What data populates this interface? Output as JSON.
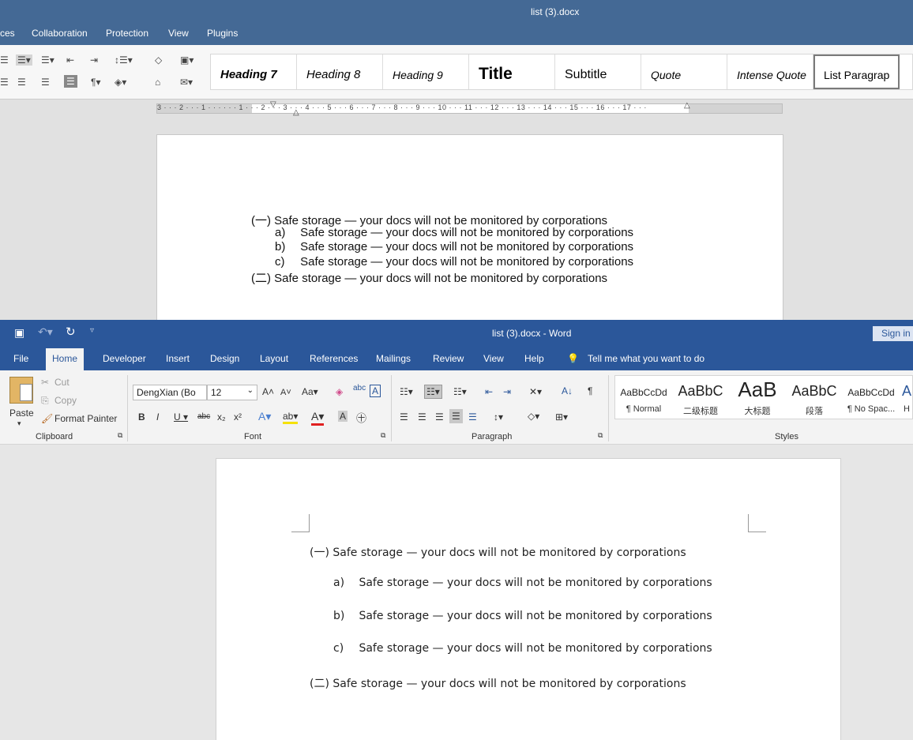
{
  "top_editor": {
    "title": "list (3).docx",
    "tabs": [
      "ces",
      "Collaboration",
      "Protection",
      "View",
      "Plugins"
    ],
    "styles": [
      "Heading 7",
      "Heading 8",
      "Heading 9",
      "Title",
      "Subtitle",
      "Quote",
      "Intense Quote",
      "List Paragrap"
    ],
    "ruler_text": "3 · · · 2 · · · 1 · · · · · · 1 · · · 2 · · · 3 · · · 4 · · · 5 · · · 6 · · · 7 · · · 8 · · · 9 · · · 10 · · · 11 · · · 12 · · · 13 · · · 14 · · · 15 · · · 16 · · · 17 · · ·",
    "document": [
      {
        "marker": "(一)",
        "text": "Safe storage — your docs will not be monitored by corporations"
      },
      {
        "marker": "a)",
        "text": "Safe storage — your docs will not be monitored by corporations"
      },
      {
        "marker": "b)",
        "text": "Safe storage — your docs will not be monitored by corporations"
      },
      {
        "marker": "c)",
        "text": "Safe storage — your docs will not be monitored by corporations"
      },
      {
        "marker": "(二)",
        "text": "Safe storage — your docs will not be monitored by corporations"
      }
    ]
  },
  "word": {
    "title": "list (3).docx  -  Word",
    "sign_in": "Sign in",
    "tabs": [
      "File",
      "Home",
      "Developer",
      "Insert",
      "Design",
      "Layout",
      "References",
      "Mailings",
      "Review",
      "View",
      "Help"
    ],
    "tell_me": "Tell me what you want to do",
    "clipboard": {
      "paste": "Paste",
      "cut": "Cut",
      "copy": "Copy",
      "format_painter": "Format Painter",
      "label": "Clipboard"
    },
    "font": {
      "name": "DengXian (Bo",
      "size": "12",
      "label": "Font"
    },
    "paragraph": {
      "label": "Paragraph"
    },
    "styles": {
      "label": "Styles",
      "items": [
        {
          "sample": "AaBbCcDd",
          "name": "¶ Normal"
        },
        {
          "sample": "AaBbC",
          "name": "二级标题"
        },
        {
          "sample": "AaB",
          "name": "大标题"
        },
        {
          "sample": "AaBbC",
          "name": "段落"
        },
        {
          "sample": "AaBbCcDd",
          "name": "¶ No Spac..."
        },
        {
          "sample": "A",
          "name": "H"
        }
      ]
    },
    "document": [
      {
        "marker": "(一)",
        "text": "Safe storage — your docs will not be monitored by corporations"
      },
      {
        "marker": "a)",
        "text": "Safe storage — your docs will not be monitored by corporations"
      },
      {
        "marker": "b)",
        "text": "Safe storage — your docs will not be monitored by corporations"
      },
      {
        "marker": "c)",
        "text": "Safe storage — your docs will not be monitored by corporations"
      },
      {
        "marker": "(二)",
        "text": "Safe storage — your docs will not be monitored by corporations"
      }
    ]
  },
  "colors": {
    "onlyoffice_header": "#446995",
    "word_header": "#2b579a",
    "ribbon": "#f3f3f3"
  }
}
